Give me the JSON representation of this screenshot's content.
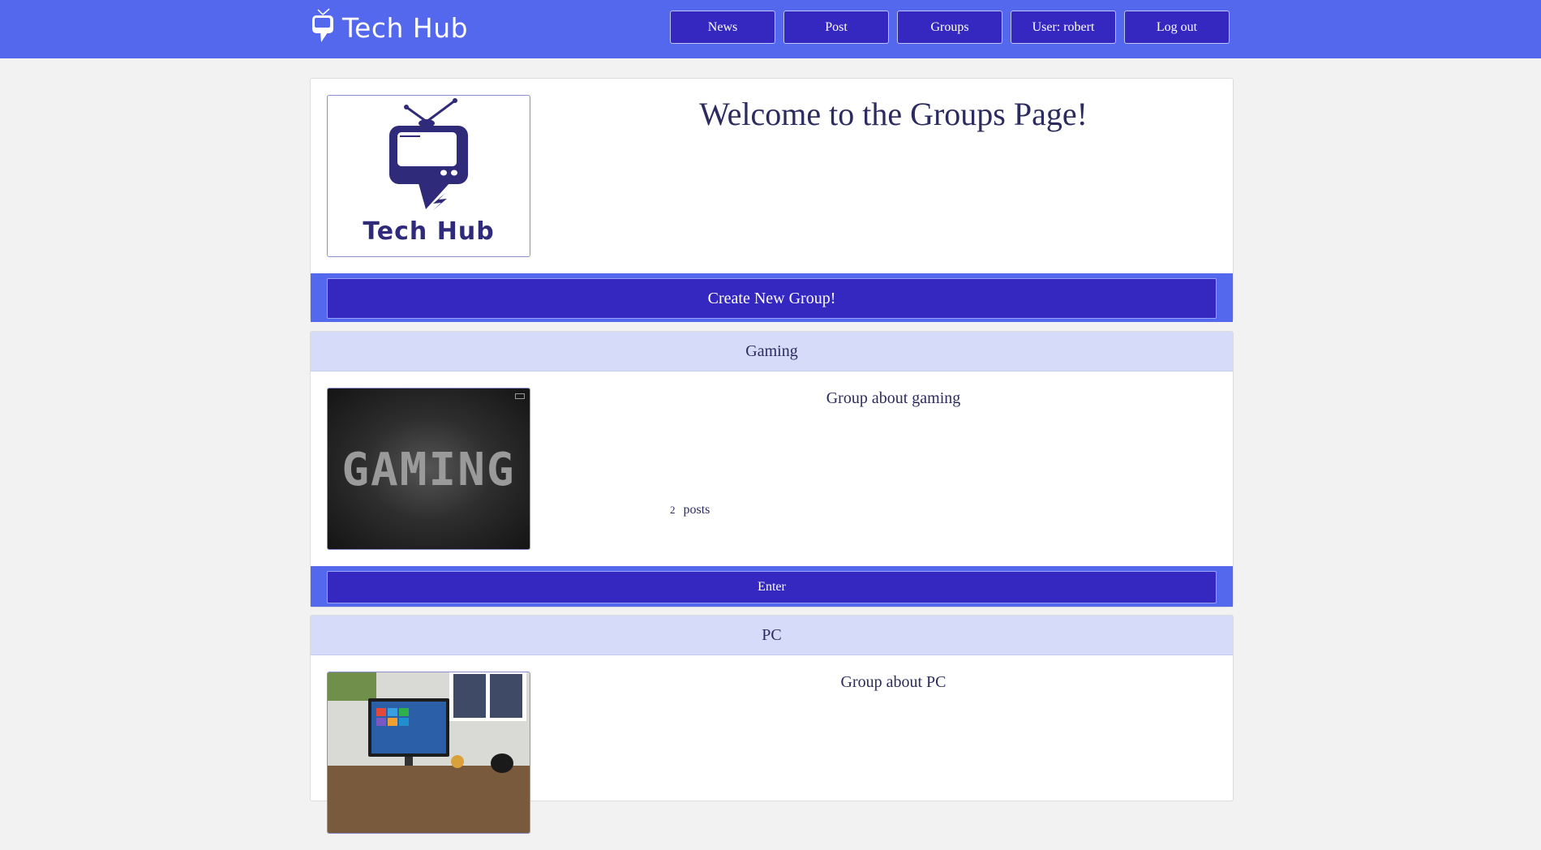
{
  "navbar": {
    "brand_name": "Tech Hub",
    "buttons": [
      {
        "label": "News"
      },
      {
        "label": "Post"
      },
      {
        "label": "Groups"
      },
      {
        "label": "User: robert"
      },
      {
        "label": "Log out"
      }
    ]
  },
  "welcome": {
    "title": "Welcome to the Groups Page!",
    "logo_text": "Tech Hub",
    "create_button_label": "Create New Group!"
  },
  "groups": [
    {
      "name": "Gaming",
      "description": "Group about gaming",
      "post_count": "2",
      "posts_label": "posts",
      "image_text": "GAMING",
      "enter_label": "Enter"
    },
    {
      "name": "PC",
      "description": "Group about PC"
    }
  ],
  "colors": {
    "navbar": "#5468ee",
    "button": "#3428c0",
    "group_header": "#d6dbf9",
    "text": "#2b2b5e"
  }
}
